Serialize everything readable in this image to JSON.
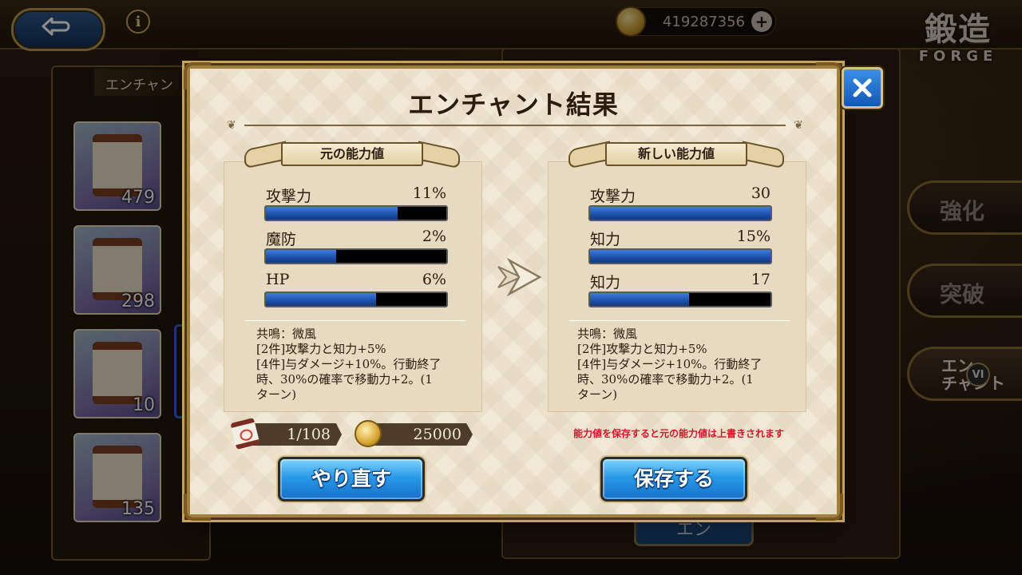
{
  "header": {
    "gold": "419287356",
    "screen_title": "鍛造",
    "screen_subtitle": "FORGE",
    "left_tab": "エンチャン"
  },
  "inventory": {
    "counts": [
      "479",
      "298",
      "10",
      "135"
    ]
  },
  "side_menu": {
    "enhance": "強化",
    "breakthrough": "突破",
    "enchant_line1": "エン",
    "enchant_line2": "チャント",
    "enchant_badge": "VI"
  },
  "background_button": "エン",
  "dialog": {
    "title": "エンチャント結果",
    "original": {
      "label": "元の能力値",
      "stats": [
        {
          "name": "攻撃力",
          "value": "11%",
          "fill": 0.73
        },
        {
          "name": "魔防",
          "value": "2%",
          "fill": 0.39
        },
        {
          "name": "HP",
          "value": "6%",
          "fill": 0.61
        }
      ],
      "resonance": {
        "line1": "共鳴：微風",
        "line2": "[2件]攻撃力と知力+5%",
        "line3": "[4件]与ダメージ+10%。行動終了",
        "line4": "時、30%の確率で移動力+2。(1",
        "line5": "ターン)"
      }
    },
    "new": {
      "label": "新しい能力値",
      "stats": [
        {
          "name": "攻撃力",
          "value": "30",
          "fill": 1.0
        },
        {
          "name": "知力",
          "value": "15%",
          "fill": 1.0
        },
        {
          "name": "知力",
          "value": "17",
          "fill": 0.55
        }
      ],
      "resonance": {
        "line1": "共鳴：微風",
        "line2": "[2件]攻撃力と知力+5%",
        "line3": "[4件]与ダメージ+10%。行動終了",
        "line4": "時、30%の確率で移動力+2。(1",
        "line5": "ターン)"
      }
    },
    "cost": {
      "scrolls": "1/108",
      "gold": "25000"
    },
    "warning": "能力値を保存すると元の能力値は上書きされます",
    "buttons": {
      "redo": "やり直す",
      "save": "保存する"
    }
  },
  "colors": {
    "bar_fill": "#1d4fa8",
    "warning": "#e0122a",
    "button_blue": "#2a9ae8"
  }
}
